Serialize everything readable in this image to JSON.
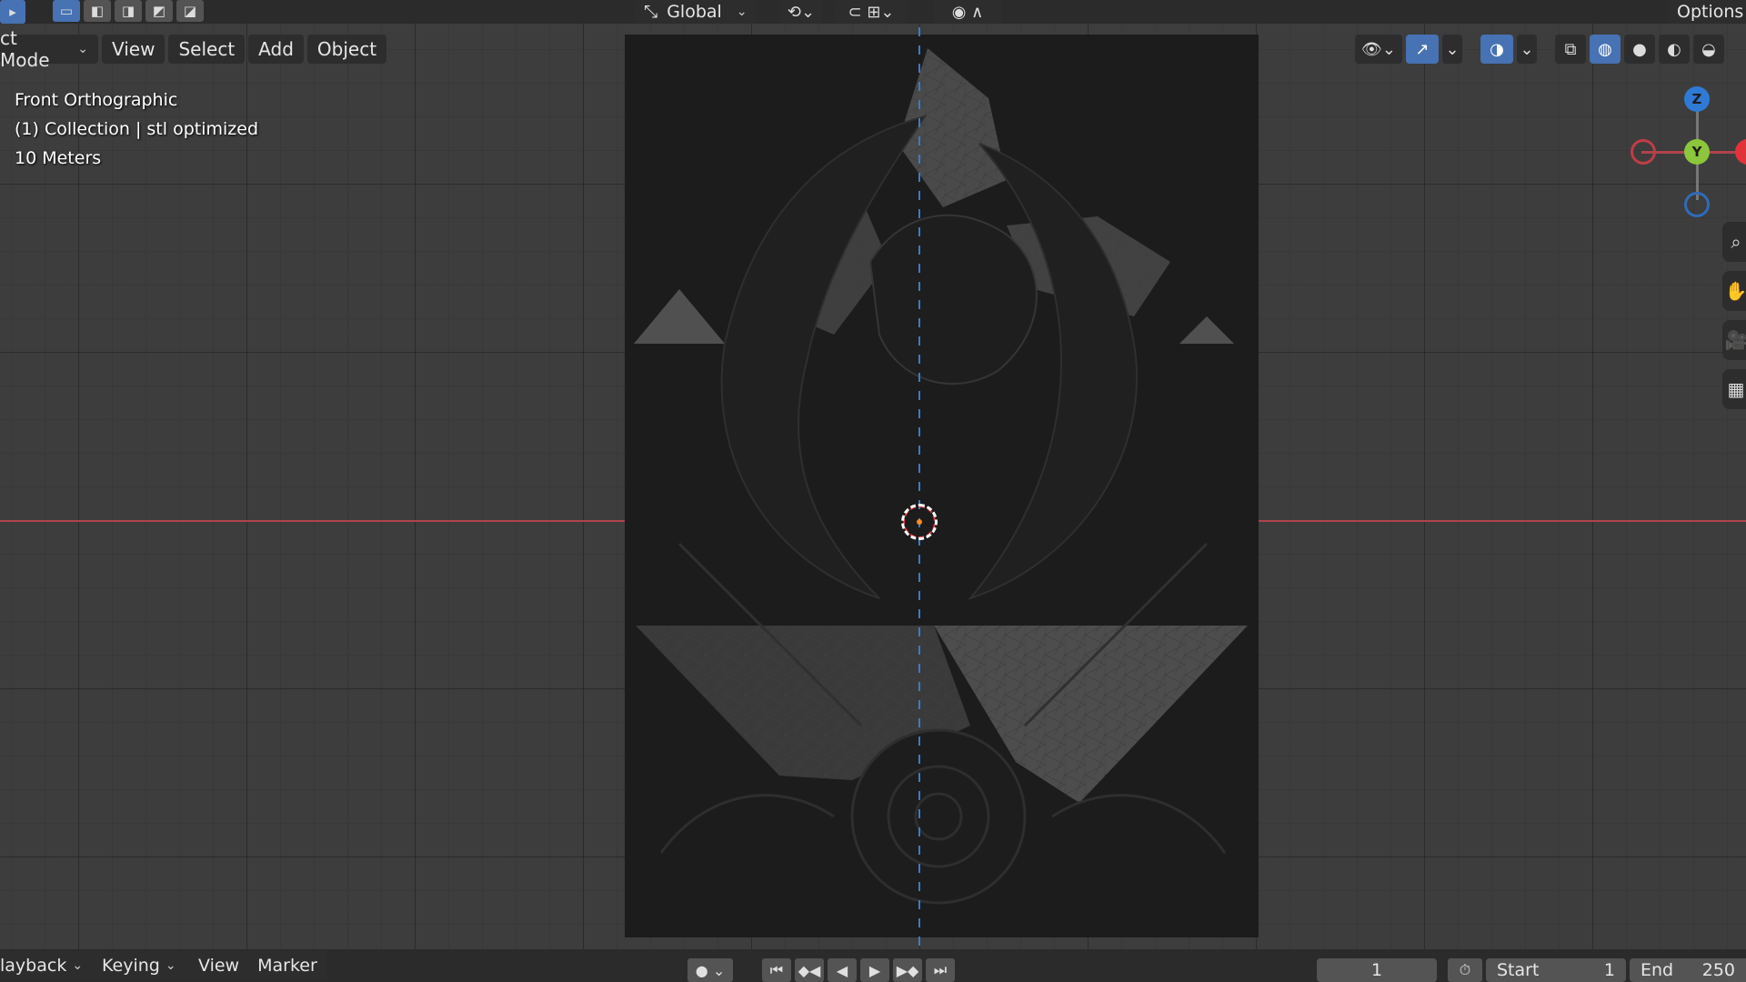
{
  "header": {
    "mode": "ct Mode",
    "menus": [
      "View",
      "Select",
      "Add",
      "Object"
    ],
    "transform_orientation": "Global",
    "options": "Options"
  },
  "viewport": {
    "view_name": "Front Orthographic",
    "collection": "(1) Collection | stl optimized",
    "scale": "10 Meters"
  },
  "gizmo": {
    "z": "Z",
    "y": "Y"
  },
  "timeline": {
    "playback": "layback",
    "keying": "Keying",
    "view": "View",
    "marker": "Marker",
    "current_frame": "1",
    "start_label": "Start",
    "start_value": "1",
    "end_label": "End",
    "end_value": "250"
  },
  "colors": {
    "x_axis": "#b0434d",
    "y_axis": "#3b7bc7",
    "accent": "#4772b3",
    "gizmo_x": "#e0333a",
    "gizmo_y": "#8bc63b",
    "gizmo_z": "#2f7ad6"
  },
  "icons": {
    "select_modes": [
      "select-box-icon",
      "select-extend-icon",
      "select-subtract-icon",
      "select-invert-icon",
      "select-intersect-icon"
    ],
    "header_right": [
      "visibility-icon",
      "gizmo-toggle-icon",
      "overlay-icon",
      "xray-icon",
      "wireframe-shading-icon",
      "solid-shading-icon",
      "material-shading-icon",
      "rendered-shading-icon"
    ],
    "side_tools": [
      "zoom-icon",
      "hand-pan-icon",
      "camera-icon",
      "grid-icon"
    ]
  }
}
